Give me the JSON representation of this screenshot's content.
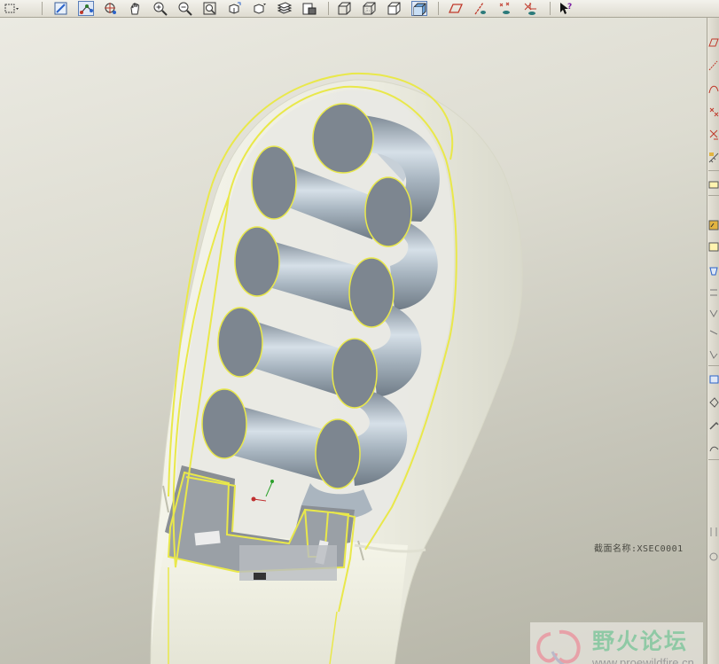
{
  "window": {
    "title": "",
    "colors": {
      "background_top": "#ebeae2",
      "background_bottom": "#b4b3a5",
      "coil": "#9aa7b2",
      "coil_cap": "#7d8690",
      "highlight_edge": "#e9e84a",
      "shell": "#f2f2e6",
      "base_cut": "#6e7278"
    }
  },
  "top_toolbar": {
    "buttons": [
      {
        "name": "select-box-icon"
      },
      {
        "name": "sketch-icon"
      },
      {
        "name": "datum-point-icon"
      },
      {
        "name": "spin-center-icon"
      },
      {
        "name": "pan-hand-icon"
      },
      {
        "name": "zoom-in-icon"
      },
      {
        "name": "zoom-out-icon"
      },
      {
        "name": "refit-icon"
      },
      {
        "name": "reorient-icon"
      },
      {
        "name": "saved-views-icon"
      },
      {
        "name": "layers-icon"
      },
      {
        "name": "model-setup-icon"
      },
      {
        "name": "wireframe-icon"
      },
      {
        "name": "hidden-line-icon"
      },
      {
        "name": "no-hidden-icon"
      },
      {
        "name": "shading-icon"
      },
      {
        "name": "datum-plane-display-icon"
      },
      {
        "name": "datum-axis-display-icon"
      },
      {
        "name": "point-display-icon"
      },
      {
        "name": "csys-display-icon"
      },
      {
        "name": "context-help-icon"
      }
    ]
  },
  "right_toolbar": {
    "buttons": [
      {
        "name": "datum-plane-icon"
      },
      {
        "name": "datum-axis-icon"
      },
      {
        "name": "datum-curve-icon"
      },
      {
        "name": "datum-point-tool-icon"
      },
      {
        "name": "datum-csys-icon"
      },
      {
        "name": "analysis-icon"
      },
      {
        "name": "extrude-icon"
      },
      {
        "name": "revolve-icon"
      },
      {
        "name": "sweep-icon"
      },
      {
        "name": "blend-icon"
      },
      {
        "name": "hole-icon"
      },
      {
        "name": "shell-icon"
      },
      {
        "name": "rib-icon"
      },
      {
        "name": "draft-icon"
      },
      {
        "name": "round-icon"
      },
      {
        "name": "chamfer-icon"
      },
      {
        "name": "mirror-icon"
      },
      {
        "name": "merge-icon"
      },
      {
        "name": "trim-icon"
      },
      {
        "name": "pattern-icon"
      }
    ]
  },
  "viewport": {
    "section_label": "截面名称:XSEC0001"
  },
  "watermark": {
    "title": "野火论坛",
    "url": "www.proewildfire.cn"
  }
}
